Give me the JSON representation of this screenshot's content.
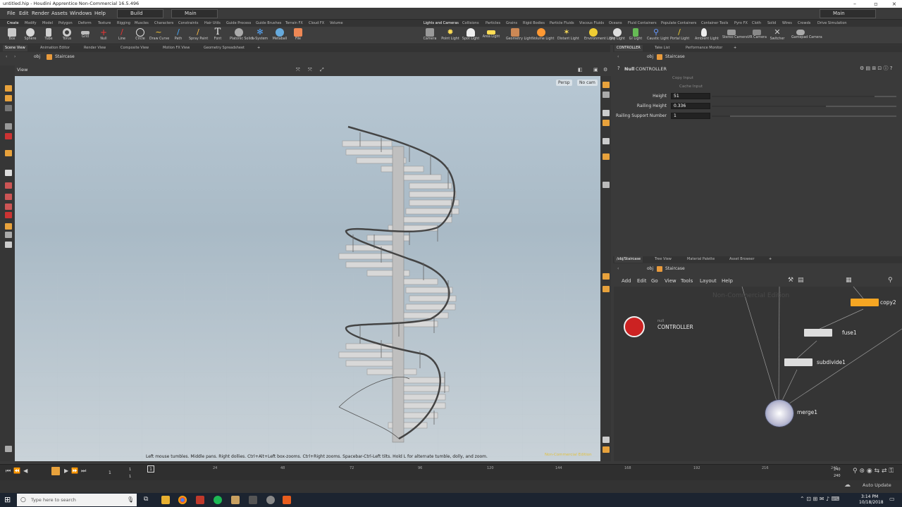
{
  "window": {
    "title": "untitled.hip - Houdini Apprentice Non-Commercial 16.5.496"
  },
  "menu": [
    "File",
    "Edit",
    "Render",
    "Assets",
    "Windows",
    "Help"
  ],
  "desktops": {
    "left": "Build",
    "right": "Main",
    "far_right": "Main"
  },
  "shelf_tabs_left": [
    "Create",
    "Modify",
    "Model",
    "Polygon",
    "Deform",
    "Texture",
    "Rigging",
    "Muscles",
    "Characters",
    "Constraints",
    "Hair Utils",
    "Guide Process",
    "Guide Brushes",
    "Terrain FX",
    "Cloud FX",
    "Volume"
  ],
  "shelf_tabs_right": [
    "Lights and Cameras",
    "Collisions",
    "Particles",
    "Grains",
    "Rigid Bodies",
    "Particle Fluids",
    "Viscous Fluids",
    "Oceans",
    "Fluid Containers",
    "Populate Containers",
    "Container Tools",
    "Pyro FX",
    "Cloth",
    "Solid",
    "Wires",
    "Crowds",
    "Drive Simulation"
  ],
  "tools_left": [
    "Box",
    "Sphere",
    "Tube",
    "Torus",
    "Grid",
    "Null",
    "Line",
    "Circle",
    "Draw Curve",
    "Path",
    "Spray Paint",
    "Font",
    "Platonic Solids",
    "L-System",
    "Metaball",
    "File"
  ],
  "tools_right": [
    "Camera",
    "Point Light",
    "Spot Light",
    "Area Light",
    "Geometry Light",
    "Volume Light",
    "Distant Light",
    "Environment Light",
    "Sky Light",
    "GI Light",
    "Caustic Light",
    "Portal Light",
    "Ambient Light",
    "Stereo Camera",
    "VR Camera",
    "Switcher",
    "Gamepad Camera"
  ],
  "pane_tabs_left": [
    "Scene View",
    "Animation Editor",
    "Render View",
    "Composite View",
    "Motion FX View",
    "Geometry Spreadsheet"
  ],
  "pane_tabs_params": [
    "CONTROLLER",
    "Take List",
    "Performance Monitor"
  ],
  "pane_tabs_net": [
    "/obj/Staircase",
    "Tree View",
    "Material Palette",
    "Asset Browser"
  ],
  "path": {
    "obj": "obj",
    "node": "Staircase"
  },
  "viewport": {
    "label": "View",
    "persp": "Persp",
    "cam": "No cam",
    "help": "Left mouse tumbles. Middle pans. Right dollies. Ctrl+Alt+Left box-zooms. Ctrl+Right zooms. Spacebar-Ctrl-Left tilts. Hold L for alternate tumble, dolly, and zoom.",
    "watermark": "Non-Commercial Edition"
  },
  "params": {
    "node_type": "Null",
    "node_name": "CONTROLLER",
    "copy_input": "Copy Input",
    "cache_input": "Cache Input",
    "rows": [
      {
        "label": "Height",
        "value": "51",
        "fill": 0.88
      },
      {
        "label": "Railing Height",
        "value": "0.336",
        "fill": 0.62
      },
      {
        "label": "Railing Support Number",
        "value": "1",
        "fill": 0.1
      }
    ]
  },
  "network": {
    "menu": [
      "Add",
      "Edit",
      "Go",
      "View",
      "Tools",
      "Layout",
      "Help"
    ],
    "watermark": "Non-Commercial Edition",
    "nodes": [
      {
        "name": "CONTROLLER",
        "type": "null"
      },
      {
        "name": "copy2"
      },
      {
        "name": "fuse1"
      },
      {
        "name": "subdivide1"
      },
      {
        "name": "merge1"
      }
    ]
  },
  "timeline": {
    "ticks": [
      "24",
      "48",
      "72",
      "96",
      "120",
      "144",
      "168",
      "192",
      "216",
      "240"
    ],
    "start": "1",
    "end": "240",
    "end2": "240",
    "current": "1",
    "frame": "1",
    "start2": "1"
  },
  "status": {
    "auto_update": "Auto Update"
  },
  "taskbar": {
    "search": "Type here to search",
    "time": "3:14 PM",
    "date": "10/18/2018"
  }
}
